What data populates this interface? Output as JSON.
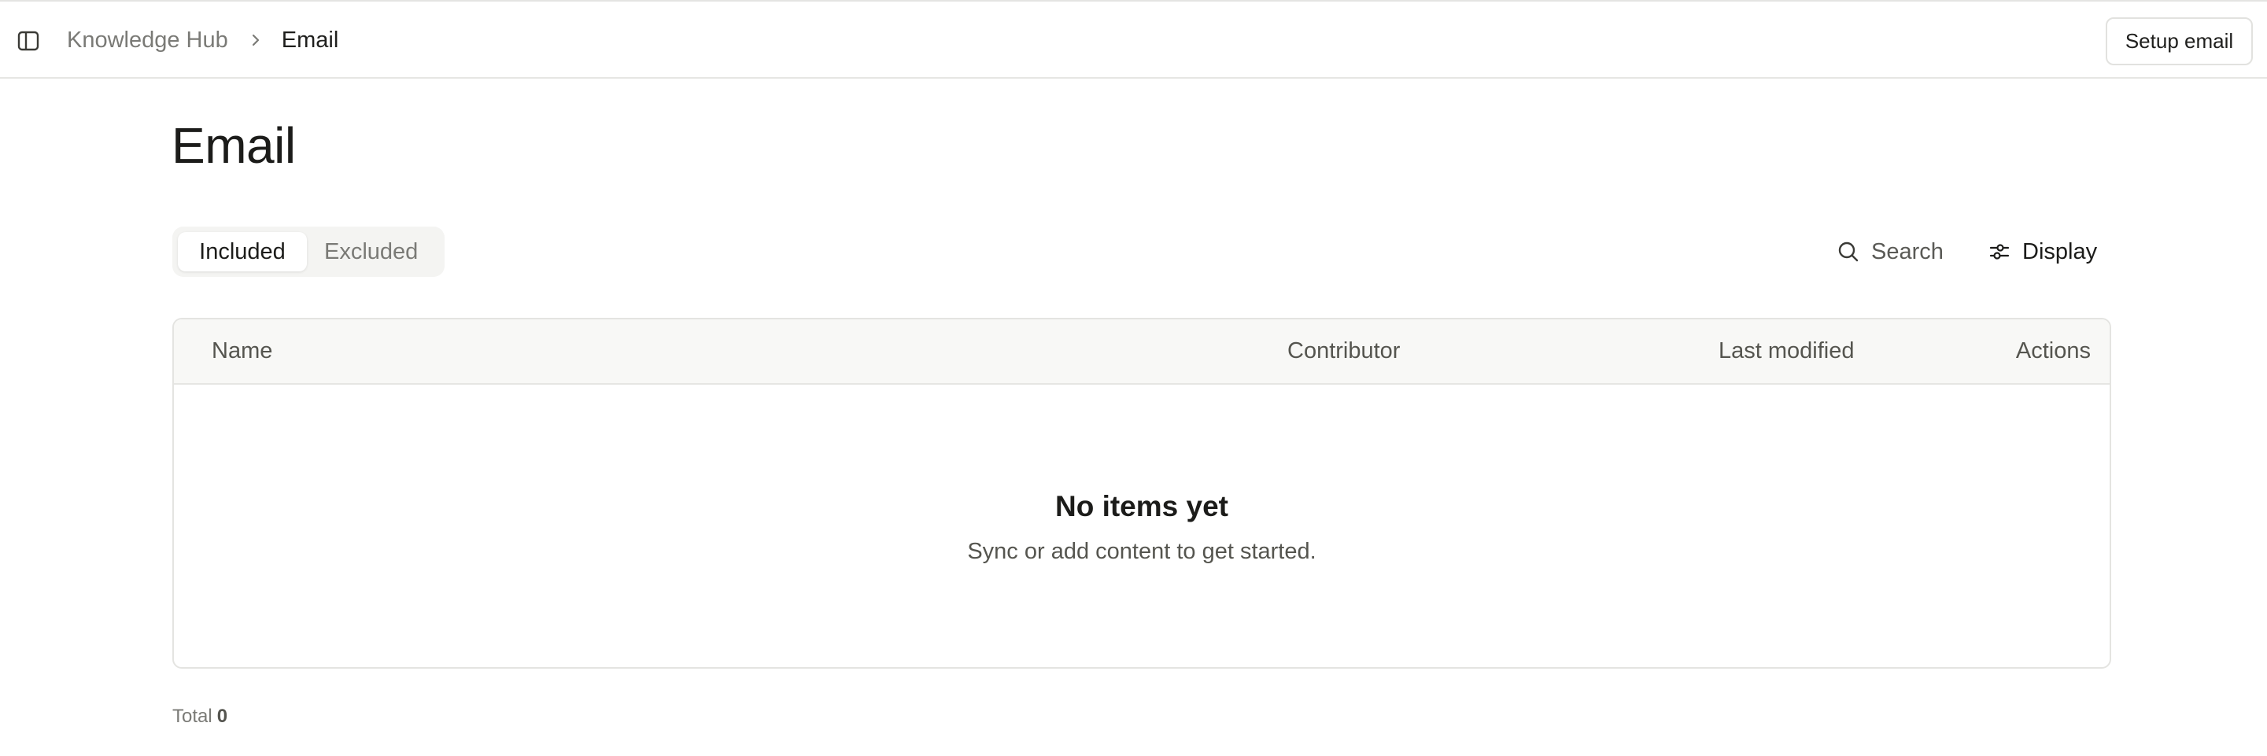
{
  "header": {
    "breadcrumb": {
      "parent": "Knowledge Hub",
      "current": "Email"
    },
    "setup_button_label": "Setup email",
    "icons": {
      "sidebar_toggle": "sidebar-panel-icon",
      "separator": "chevron-right-icon"
    }
  },
  "page": {
    "title": "Email"
  },
  "tabs": [
    {
      "label": "Included",
      "active": true
    },
    {
      "label": "Excluded",
      "active": false
    }
  ],
  "toolbar": {
    "search_label": "Search",
    "display_label": "Display",
    "icons": {
      "search": "search-icon",
      "display": "sliders-icon"
    }
  },
  "table": {
    "columns": [
      "Name",
      "Contributor",
      "Last modified",
      "Actions"
    ],
    "rows": [],
    "empty_state": {
      "title": "No items yet",
      "subtitle": "Sync or add content to get started."
    }
  },
  "footer": {
    "total_label": "Total",
    "total_count": "0"
  },
  "colors": {
    "text_primary": "#1c1c1a",
    "text_muted": "#7a7a76",
    "border": "#e4e4e1",
    "table_header_bg": "#f8f8f6",
    "tabs_bg": "#f4f4f2"
  }
}
